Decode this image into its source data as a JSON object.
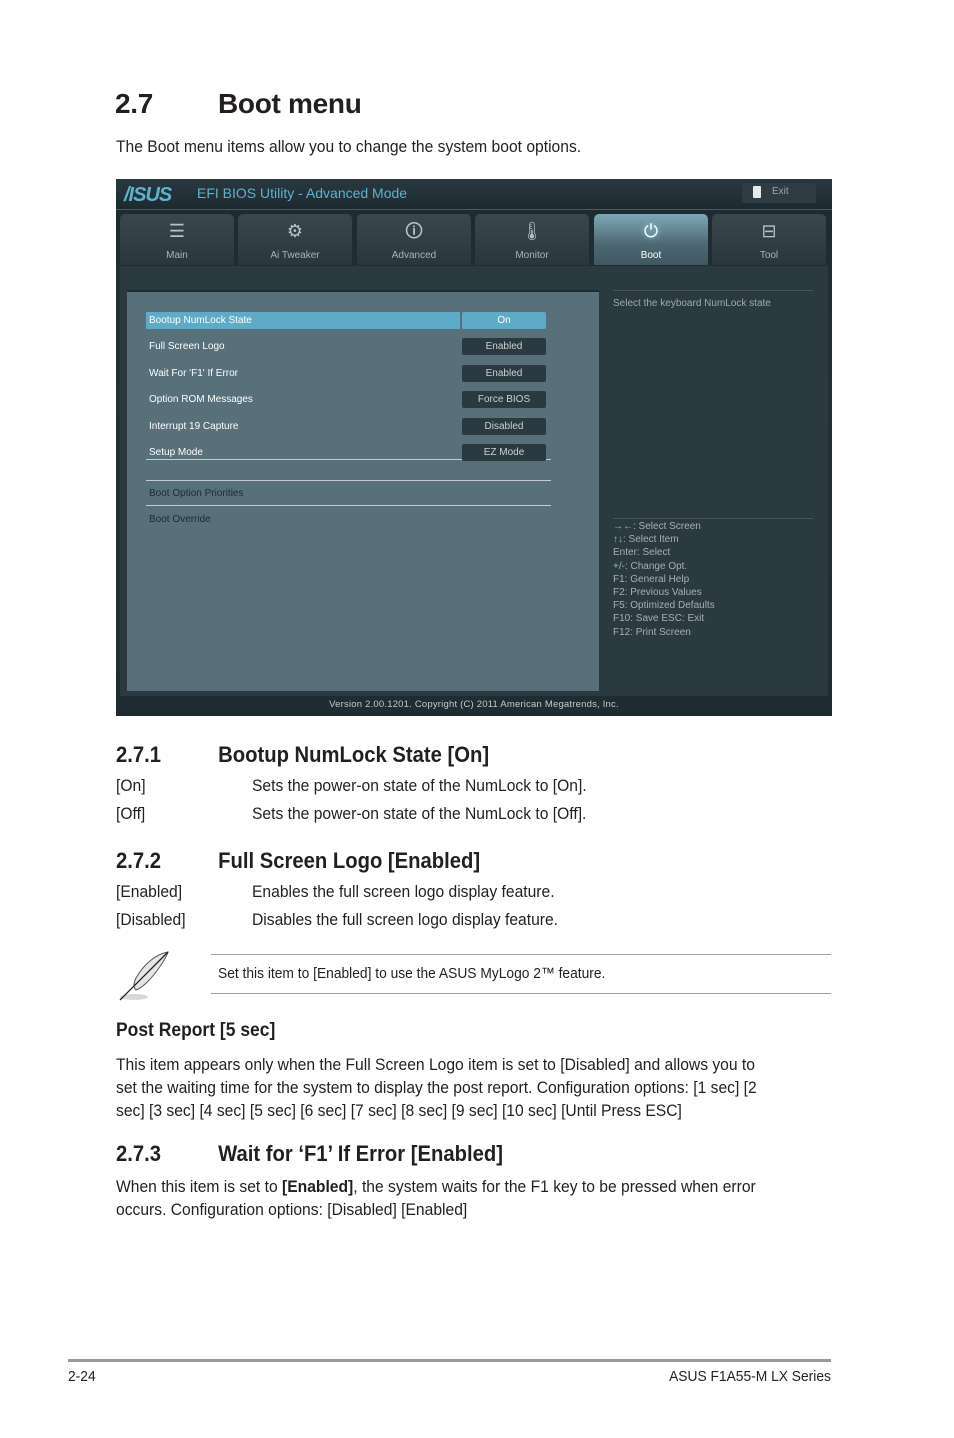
{
  "section": {
    "number": "2.7",
    "title": "Boot menu",
    "intro": "The Boot menu items allow you to change the system boot options."
  },
  "bios": {
    "logo": "/ISUS",
    "title": "EFI BIOS Utility - Advanced Mode",
    "exit_label": "Exit",
    "tabs": [
      {
        "label": "Main",
        "icon": "list-icon",
        "glyph": "☰",
        "active": false
      },
      {
        "label": "Ai  Tweaker",
        "icon": "tweaker-icon",
        "glyph": "⚙",
        "active": false
      },
      {
        "label": "Advanced",
        "icon": "advanced-info-icon",
        "glyph": "🛈",
        "active": false
      },
      {
        "label": "Monitor",
        "icon": "thermometer-icon",
        "glyph": "🌡",
        "active": false
      },
      {
        "label": "Boot",
        "icon": "power-icon",
        "glyph": "⏻",
        "active": true
      },
      {
        "label": "Tool",
        "icon": "toolbox-icon",
        "glyph": "⊟",
        "active": false
      }
    ],
    "settings": [
      {
        "label": "Bootup NumLock State",
        "value": "On",
        "selected": true
      },
      {
        "label": "Full Screen Logo",
        "value": "Enabled",
        "selected": false
      },
      {
        "label": "Wait For 'F1' If Error",
        "value": "Enabled",
        "selected": false
      },
      {
        "label": "Option ROM Messages",
        "value": "Force BIOS",
        "selected": false
      },
      {
        "label": "Interrupt 19 Capture",
        "value": "Disabled",
        "selected": false
      },
      {
        "label": "Setup Mode",
        "value": "EZ Mode",
        "selected": false
      }
    ],
    "submenus": [
      "Boot Option Priorities",
      "Boot Override"
    ],
    "help_text": "Select the keyboard NumLock state",
    "key_legend": [
      "→←:  Select Screen",
      "↑↓:  Select Item",
      "Enter:  Select",
      "+/-:  Change Opt.",
      "F1:  General Help",
      "F2:  Previous Values",
      "F5:  Optimized Defaults",
      "F10:  Save    ESC:  Exit",
      "F12:  Print Screen"
    ],
    "footer": "Version  2.00.1201.   Copyright  (C)  2011  American  Megatrends,  Inc.",
    "colors": {
      "accent": "#5eabc7",
      "pane": "#57707a",
      "background": "#233137"
    }
  },
  "s271": {
    "number": "2.7.1",
    "title": "Bootup NumLock State [On]",
    "options": [
      {
        "key": "[On]",
        "desc": "Sets the power-on state of the NumLock to [On]."
      },
      {
        "key": "[Off]",
        "desc": "Sets the power-on state of the NumLock to [Off]."
      }
    ]
  },
  "s272": {
    "number": "2.7.2",
    "title": "Full Screen Logo [Enabled]",
    "options": [
      {
        "key": "[Enabled]",
        "desc": "Enables the full screen logo display feature."
      },
      {
        "key": "[Disabled]",
        "desc": "Disables the full screen logo display feature."
      }
    ]
  },
  "note": {
    "icon": "feather-pen-icon",
    "text": "Set this item to [Enabled] to use the ASUS MyLogo 2™ feature."
  },
  "post_report": {
    "title": "Post Report [5 sec]",
    "line1": "This item appears only when the Full Screen Logo item is set to [Disabled] and allows you to",
    "line2": "set the waiting time for the system to display the post report. Configuration options: [1 sec] [2",
    "line3": "sec] [3 sec] [4 sec] [5 sec] [6 sec] [7 sec] [8 sec] [9 sec] [10 sec] [Until Press ESC]"
  },
  "s273": {
    "number": "2.7.3",
    "title": "Wait for ‘F1’ If Error [Enabled]",
    "line1_pre": "When this item is set to ",
    "line1_bold": "[Enabled]",
    "line1_post": ", the system waits for the F1 key to be pressed when error",
    "line2": "occurs. Configuration options: [Disabled] [Enabled]"
  },
  "page_footer": {
    "page_number": "2-24",
    "product": "ASUS F1A55-M LX Series"
  }
}
